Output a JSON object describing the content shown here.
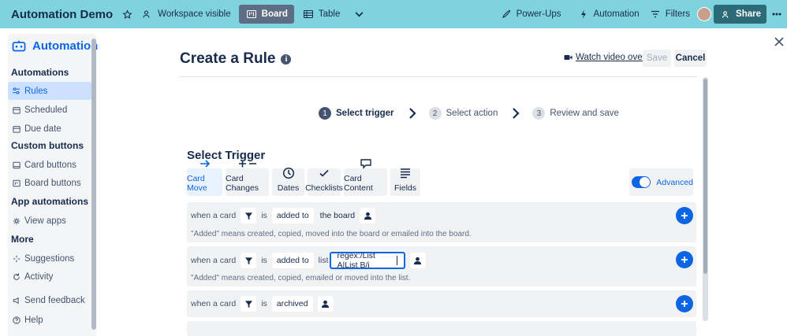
{
  "topbar": {
    "board_name": "Automation Demo",
    "visibility": "Workspace visible",
    "view_board": "Board",
    "view_table": "Table",
    "power_ups": "Power-Ups",
    "automation": "Automation",
    "filters": "Filters",
    "share": "Share"
  },
  "sidebar": {
    "title": "Automation",
    "sections": [
      {
        "title": "Automations",
        "items": [
          {
            "label": "Rules",
            "icon": "rules-icon",
            "active": true
          },
          {
            "label": "Scheduled",
            "icon": "calendar-icon"
          },
          {
            "label": "Due date",
            "icon": "calendar-icon"
          }
        ]
      },
      {
        "title": "Custom buttons",
        "items": [
          {
            "label": "Card buttons",
            "icon": "card-button-icon"
          },
          {
            "label": "Board buttons",
            "icon": "board-button-icon"
          }
        ]
      },
      {
        "title": "App automations",
        "items": [
          {
            "label": "View apps",
            "icon": "gear-icon"
          }
        ]
      },
      {
        "title": "More",
        "items": [
          {
            "label": "Suggestions",
            "icon": "sparkle-icon"
          },
          {
            "label": "Activity",
            "icon": "refresh-icon"
          },
          {
            "label": "Send feedback",
            "icon": "megaphone-icon"
          },
          {
            "label": "Help",
            "icon": "help-icon"
          }
        ]
      }
    ]
  },
  "editor": {
    "title": "Create a Rule",
    "watch_video": "Watch video overview",
    "save": "Save",
    "cancel": "Cancel",
    "steps": [
      {
        "num": "1",
        "label": "Select trigger"
      },
      {
        "num": "2",
        "label": "Select action"
      },
      {
        "num": "3",
        "label": "Review and save"
      }
    ],
    "select_trigger_title": "Select Trigger",
    "trigger_tabs": [
      "Card Move",
      "Card Changes",
      "Dates",
      "Checklists",
      "Card Content",
      "Fields"
    ],
    "advanced": "Advanced",
    "triggers": [
      {
        "when": "when a card",
        "is": "is",
        "action": "added to",
        "target": "the board",
        "hint": "\"Added\" means created, copied, moved into the board or emailed into the board."
      },
      {
        "when": "when a card",
        "is": "is",
        "action": "added to",
        "list_word": "list",
        "list_value": "regex:/List A|List B/i",
        "hint": "\"Added\" means created, copied, emailed or moved into the list."
      },
      {
        "when": "when a card",
        "is": "is",
        "action": "archived"
      }
    ]
  },
  "colors": {
    "accent": "#0c66e4",
    "topbar": "#7fd3df"
  }
}
